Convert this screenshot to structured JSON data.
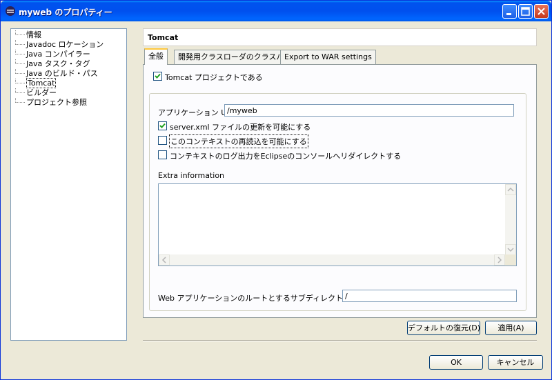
{
  "window": {
    "title": "myweb のプロパティー"
  },
  "tree": {
    "items": [
      {
        "label": "情報"
      },
      {
        "label": "Javadoc ロケーション"
      },
      {
        "label": "Java コンパイラー"
      },
      {
        "label": "Java タスク・タグ"
      },
      {
        "label": "Java のビルド・パス"
      },
      {
        "label": "Tomcat",
        "selected": true
      },
      {
        "label": "ビルダー"
      },
      {
        "label": "プロジェクト参照"
      }
    ]
  },
  "page": {
    "title": "Tomcat"
  },
  "tabs": [
    {
      "label": "全般",
      "active": true
    },
    {
      "label": "開発用クラスローダのクラスパス"
    },
    {
      "label": "Export to WAR settings"
    }
  ],
  "general": {
    "is_tomcat_project": {
      "label": "Tomcat プロジェクトである",
      "checked": true
    },
    "app_uri": {
      "label": "アプリケーション URI",
      "value": "/myweb"
    },
    "options": [
      {
        "label": "server.xml ファイルの更新を可能にする",
        "checked": true
      },
      {
        "label": "このコンテキストの再読込を可能にする",
        "checked": false
      },
      {
        "label": "コンテキストのログ出力をEclipseのコンソールへリダイレクトする",
        "checked": false
      }
    ],
    "extra_info": {
      "label": "Extra information",
      "value": ""
    },
    "subdir": {
      "label": "Web アプリケーションのルートとするサブディレクトリ(任意)",
      "value": "/"
    }
  },
  "buttons": {
    "restore_defaults": "デフォルトの復元(D)",
    "apply": "適用(A)",
    "ok": "OK",
    "cancel": "キャンセル"
  }
}
